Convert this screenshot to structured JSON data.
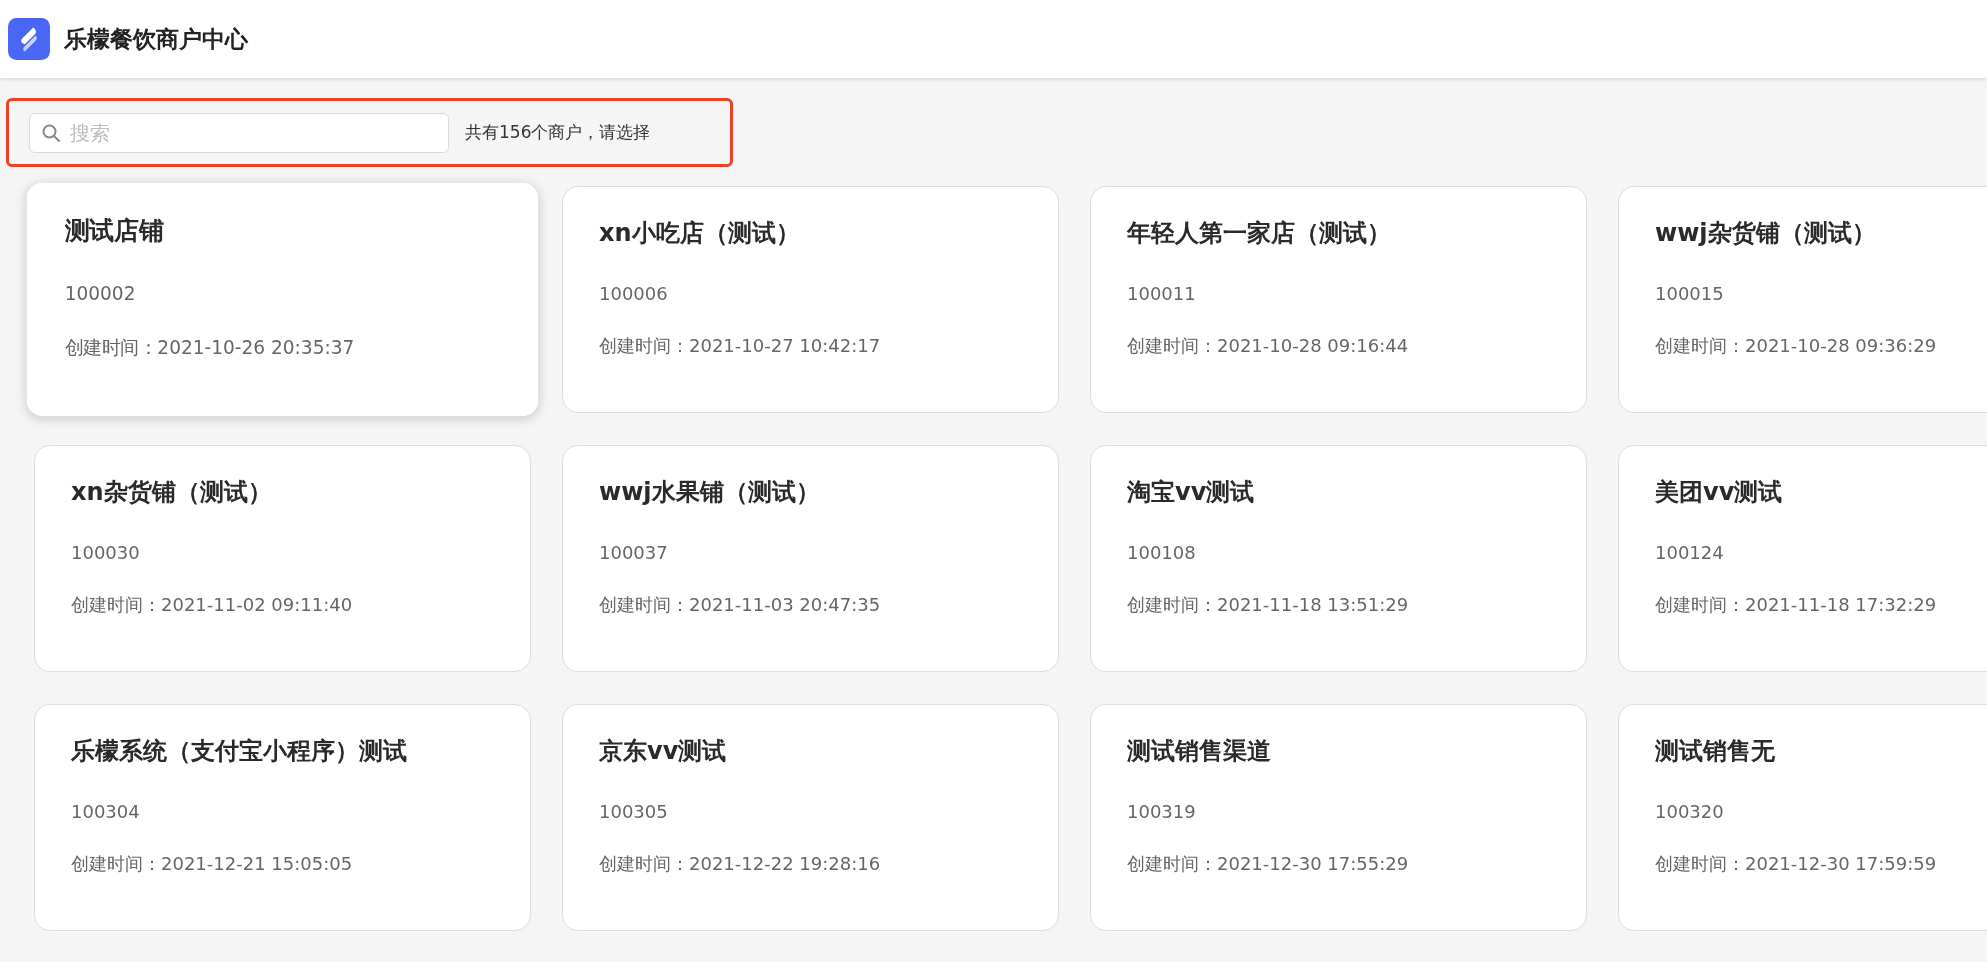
{
  "header": {
    "title": "乐檬餐饮商户中心"
  },
  "toolbar": {
    "highlighted": true,
    "search": {
      "placeholder": "搜索"
    },
    "count_text": "共有156个商户，请选择"
  },
  "merchants": [
    {
      "name": "测试店铺",
      "id": "100002",
      "created": "创建时间：2021-10-26 20:35:37",
      "selected": true
    },
    {
      "name": "xn小吃店（测试）",
      "id": "100006",
      "created": "创建时间：2021-10-27 10:42:17",
      "selected": false
    },
    {
      "name": "年轻人第一家店（测试）",
      "id": "100011",
      "created": "创建时间：2021-10-28 09:16:44",
      "selected": false
    },
    {
      "name": "wwj杂货铺（测试）",
      "id": "100015",
      "created": "创建时间：2021-10-28 09:36:29",
      "selected": false
    },
    {
      "name": "xn杂货铺（测试）",
      "id": "100030",
      "created": "创建时间：2021-11-02 09:11:40",
      "selected": false
    },
    {
      "name": "wwj水果铺（测试）",
      "id": "100037",
      "created": "创建时间：2021-11-03 20:47:35",
      "selected": false
    },
    {
      "name": "淘宝vv测试",
      "id": "100108",
      "created": "创建时间：2021-11-18 13:51:29",
      "selected": false
    },
    {
      "name": "美团vv测试",
      "id": "100124",
      "created": "创建时间：2021-11-18 17:32:29",
      "selected": false
    },
    {
      "name": "乐檬系统（支付宝小程序）测试",
      "id": "100304",
      "created": "创建时间：2021-12-21 15:05:05",
      "selected": false
    },
    {
      "name": "京东vv测试",
      "id": "100305",
      "created": "创建时间：2021-12-22 19:28:16",
      "selected": false
    },
    {
      "name": "测试销售渠道",
      "id": "100319",
      "created": "创建时间：2021-12-30 17:55:29",
      "selected": false
    },
    {
      "name": "测试销售无",
      "id": "100320",
      "created": "创建时间：2021-12-30 17:59:59",
      "selected": false
    }
  ]
}
